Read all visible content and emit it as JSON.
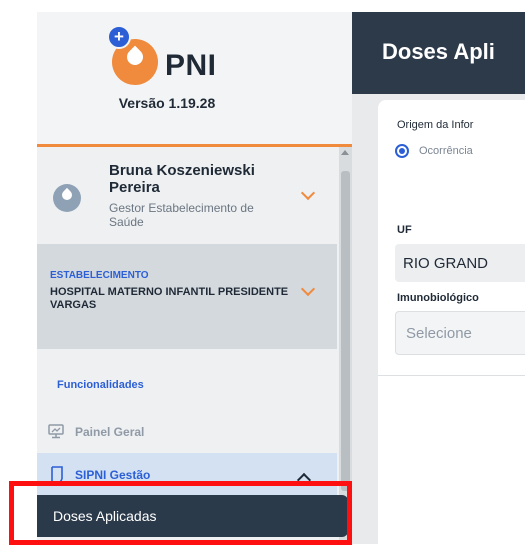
{
  "brand": {
    "name": "PNI",
    "version": "Versão 1.19.28"
  },
  "user": {
    "name": "Bruna Koszeniewski Pereira",
    "role": "Gestor Estabelecimento de Saúde"
  },
  "establishment": {
    "label": "ESTABELECIMENTO",
    "name": "HOSPITAL MATERNO INFANTIL PRESIDENTE VARGAS"
  },
  "sidebar": {
    "section_title": "Funcionalidades",
    "items": [
      {
        "label": "Painel Geral"
      },
      {
        "label": "SIPNI Gestão"
      }
    ],
    "active_subitem": "Doses Aplicadas"
  },
  "main": {
    "page_title": "Doses Apli",
    "origem_label": "Origem da Infor",
    "radio_option": "Ocorrência",
    "uf_label": "UF",
    "uf_value": "RIO GRAND",
    "imuno_label": "Imunobiológico",
    "imuno_placeholder": "Selecione"
  },
  "colors": {
    "accent_orange": "#f08a3c",
    "accent_blue": "#2c5fd6",
    "dark_navy": "#2b3a4a",
    "highlight_red": "#ff1010"
  }
}
